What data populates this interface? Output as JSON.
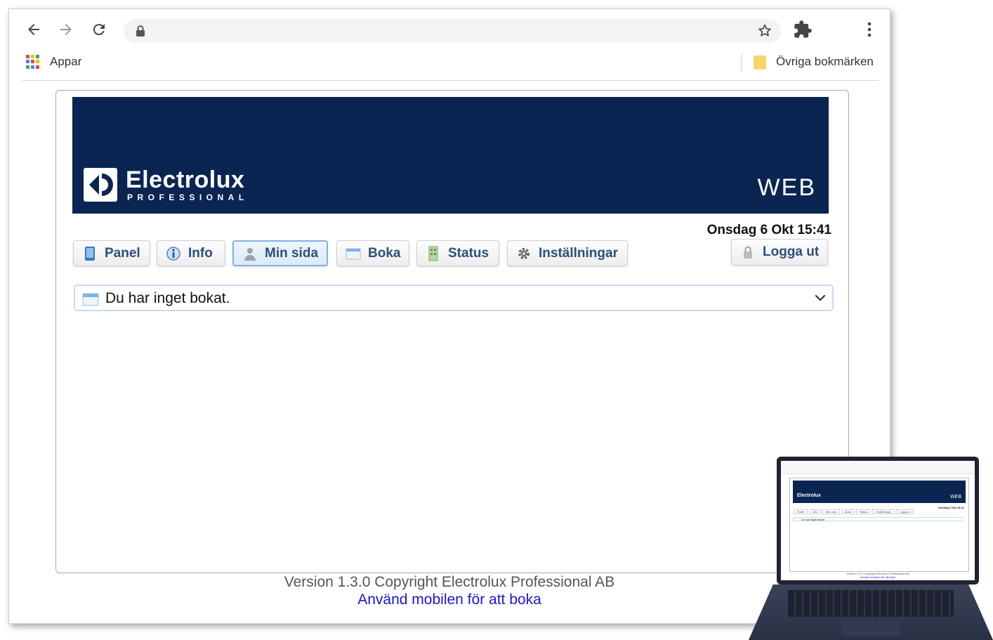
{
  "browser": {
    "bookmarks": {
      "apps_label": "Appar",
      "other_label": "Övriga bokmärken"
    }
  },
  "header": {
    "brand_name": "Electrolux",
    "brand_sub": "PROFESSIONAL",
    "web_label": "WEB"
  },
  "datetime": "Onsdag 6 Okt 15:41",
  "nav": {
    "tabs": [
      {
        "label": "Panel",
        "icon": "tablet-icon"
      },
      {
        "label": "Info",
        "icon": "info-icon"
      },
      {
        "label": "Min sida",
        "icon": "user-icon",
        "active": true
      },
      {
        "label": "Boka",
        "icon": "calendar-icon"
      },
      {
        "label": "Status",
        "icon": "building-icon"
      },
      {
        "label": "Inställningar",
        "icon": "gear-icon"
      }
    ],
    "logout_label": "Logga ut"
  },
  "booking_select": {
    "value": "Du har inget bokat."
  },
  "footer": {
    "version": "Version 1.3.0 Copyright Electrolux Professional AB",
    "mobile_link": "Använd mobilen för att boka"
  },
  "laptop_preview": {
    "brand": "Electrolux",
    "web": "WEB",
    "date": "Onsdag 6 Okt 15:41",
    "tabs": [
      "Panel",
      "Info",
      "Min sida",
      "Boka",
      "Status",
      "Inställningar"
    ],
    "logout": "Logga ut",
    "select": "Du har inget bokat.",
    "version": "Version 1.3.0 Copyright Electrolux Professional AB",
    "link": "Använd mobilen för att boka"
  },
  "colors": {
    "banner": "#0a2551",
    "tab_text": "#2e4f7a",
    "active_tab_border": "#7fb2e8",
    "link": "#1a14e6"
  }
}
